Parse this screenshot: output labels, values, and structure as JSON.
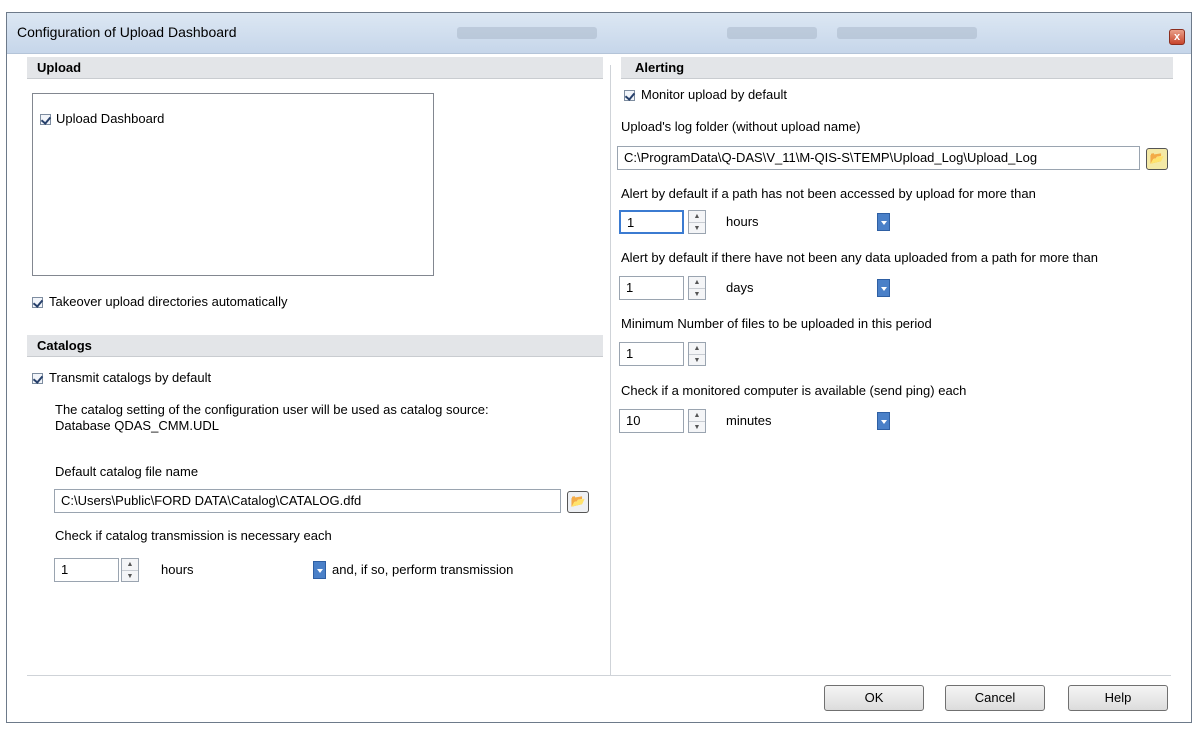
{
  "window": {
    "title": "Configuration of Upload Dashboard",
    "close_label": "x"
  },
  "upload": {
    "header": "Upload",
    "list_items": [
      {
        "label": "Upload Dashboard",
        "checked": true
      }
    ],
    "takeover_label": "Takeover upload directories automatically"
  },
  "catalogs": {
    "header": "Catalogs",
    "transmit_label": "Transmit catalogs by default",
    "info_line1": "The catalog setting of the configuration user will be used as catalog source:",
    "info_line2": "Database QDAS_CMM.UDL",
    "file_label": "Default catalog file name",
    "file_value": "C:\\Users\\Public\\FORD DATA\\Catalog\\CATALOG.dfd",
    "check_label": "Check if catalog transmission is necessary each",
    "interval_value": "1",
    "interval_unit": "hours",
    "interval_suffix": "and, if so, perform transmission"
  },
  "alerting": {
    "header": "Alerting",
    "monitor_label": "Monitor upload by default",
    "log_folder_label": "Upload's log folder (without upload name)",
    "log_folder_value": "C:\\ProgramData\\Q-DAS\\V_11\\M-QIS-S\\TEMP\\Upload_Log\\Upload_Log",
    "access_label": "Alert by default if a path has not been accessed by upload for more than",
    "access_value": "1",
    "access_unit": "hours",
    "data_label": "Alert by default if there have not been any data uploaded from a path for more than",
    "data_value": "1",
    "data_unit": "days",
    "min_files_label": "Minimum Number of files to be uploaded in this period",
    "min_files_value": "1",
    "ping_label": "Check if a monitored computer is available (send ping) each",
    "ping_value": "10",
    "ping_unit": "minutes"
  },
  "buttons": {
    "ok": "OK",
    "cancel": "Cancel",
    "help": "Help"
  },
  "icons": {
    "browse": "folder-open-icon",
    "dropdown": "chevron-down-icon",
    "spin": "spin-updown-icon"
  },
  "colors": {
    "accent": "#4a80c8",
    "titlebar": "#c6d6ea",
    "section_header": "#e3e5e8"
  }
}
